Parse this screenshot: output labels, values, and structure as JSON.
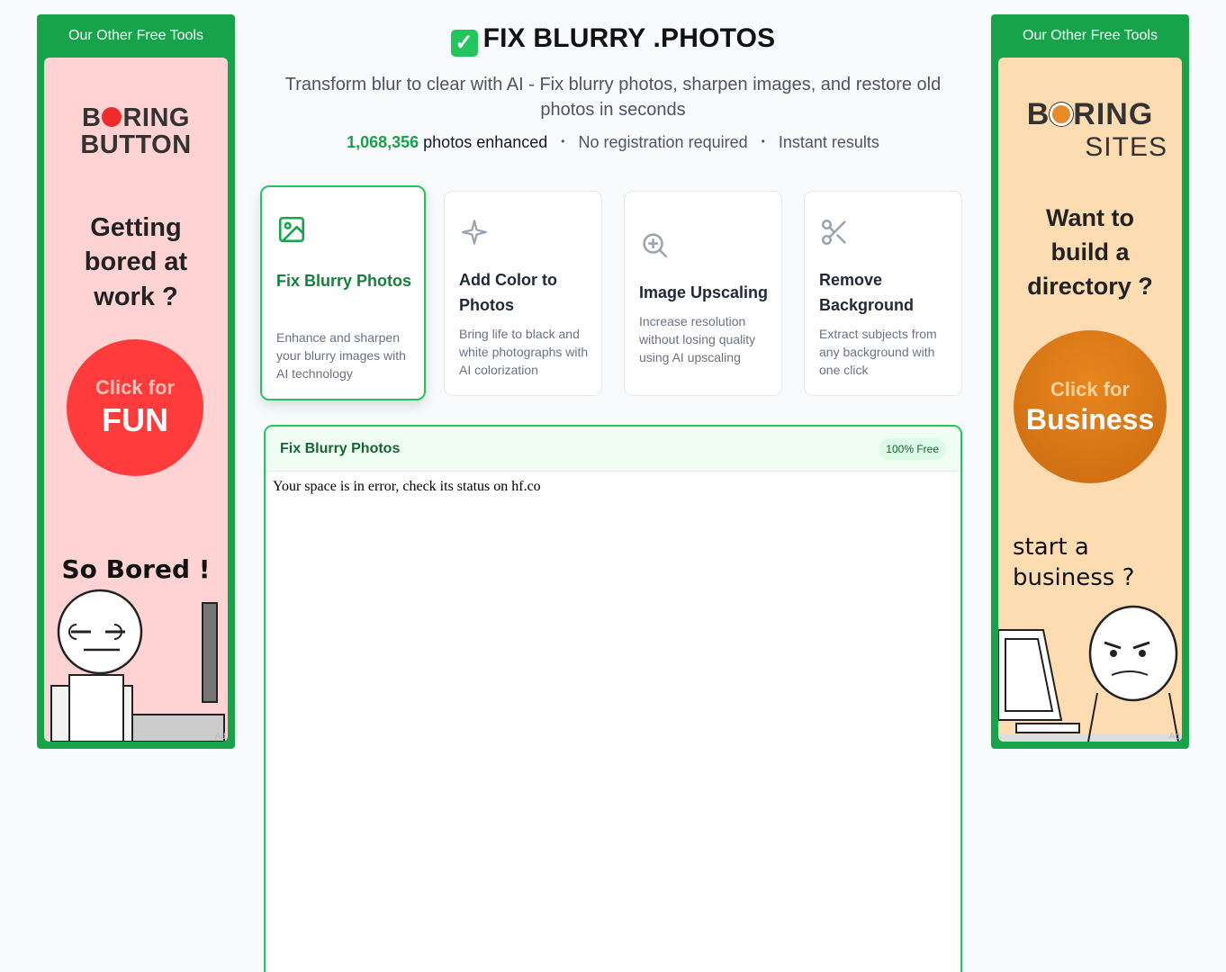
{
  "ads": {
    "left": {
      "header": "Our Other Free Tools",
      "brand_line1_pre": "B",
      "brand_line1_post": "RING",
      "brand_line2": "BUTTON",
      "tagline": "Getting bored at work ?",
      "cta_line1": "Click for",
      "cta_line2": "FUN",
      "caption": "So Bored !",
      "ad_mark": "Ad"
    },
    "right": {
      "header": "Our Other Free Tools",
      "brand_line1_pre": "B",
      "brand_line1_post": "RING",
      "brand_line2": "SITES",
      "tagline": "Want to build a directory ?",
      "cta_line1": "Click for",
      "cta_line2": "Business",
      "caption": "start a business ?",
      "ad_mark": "Ad"
    }
  },
  "header": {
    "check_glyph": "✓",
    "title": "FIX BLURRY .PHOTOS",
    "subtitle": "Transform blur to clear with AI - Fix blurry photos, sharpen images, and restore old photos in seconds",
    "count": "1,068,356",
    "count_label": "photos enhanced",
    "stat2": "No registration required",
    "stat3": "Instant results",
    "sep": "•"
  },
  "tools": [
    {
      "name": "Fix Blurry Photos",
      "desc": "Enhance and sharpen your blurry images with AI technology",
      "icon": "image-icon",
      "active": true
    },
    {
      "name": "Add Color to Photos",
      "desc": "Bring life to black and white photographs with AI colorization",
      "icon": "sparkle-icon",
      "active": false
    },
    {
      "name": "Image Upscaling",
      "desc": "Increase resolution without losing quality using AI upscaling",
      "icon": "zoom-in-icon",
      "active": false
    },
    {
      "name": "Remove Background",
      "desc": "Extract subjects from any background with one click",
      "icon": "scissors-icon",
      "active": false
    }
  ],
  "panel": {
    "title": "Fix Blurry Photos",
    "badge": "100% Free",
    "message": "Your space is in error, check its status on hf.co"
  },
  "colors": {
    "accent": "#16a34a",
    "active_border": "#22c55e",
    "ad_left_bg": "#ffd3d3",
    "ad_right_bg": "#fddcb1",
    "cta_left": "#ff3b3b",
    "cta_right": "#d97716"
  }
}
